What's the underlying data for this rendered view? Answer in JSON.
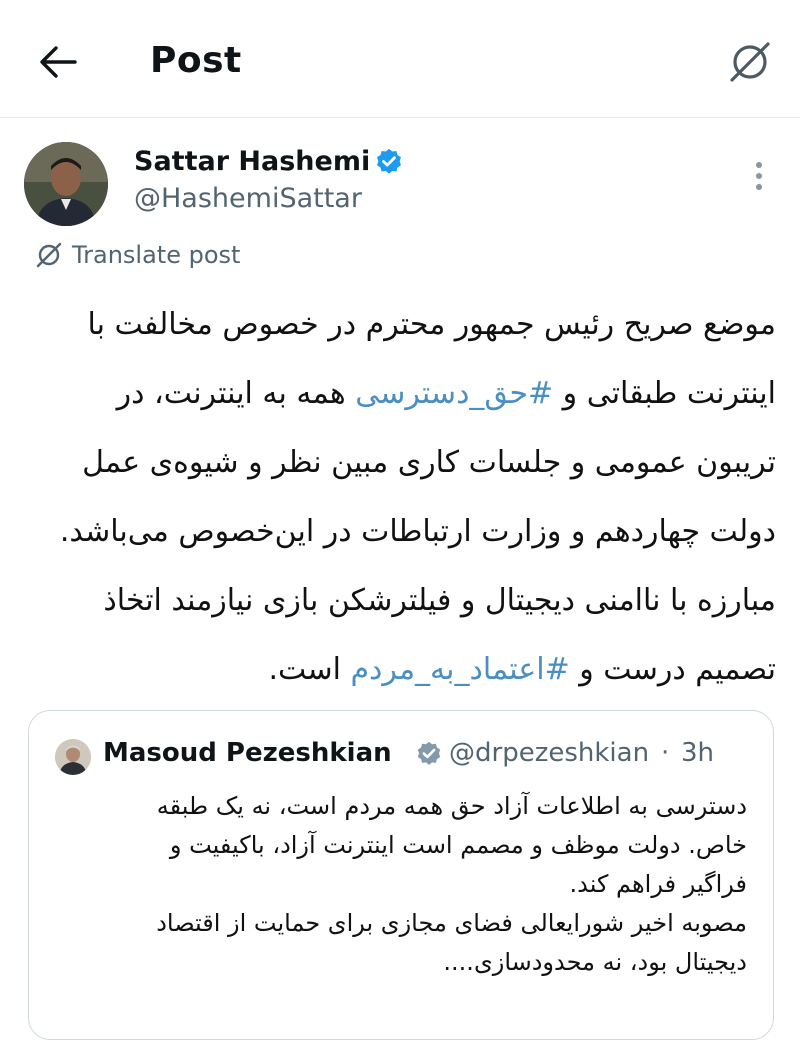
{
  "header": {
    "title": "Post",
    "back_icon": "arrow-left-icon",
    "right_icon": "no-translate-icon"
  },
  "post": {
    "author_name": "Sattar Hashemi",
    "author_handle": "@HashemiSattar",
    "verified": true,
    "translate_label": "Translate post",
    "text_segments": [
      {
        "type": "text",
        "value": "موضع صریح رئیس جمهور محترم در خصوص مخالفت با اینترنت طبقاتی و "
      },
      {
        "type": "hashtag",
        "value": "#حق_دسترسی"
      },
      {
        "type": "text",
        "value": " همه به اینترنت، در تریبون عمومی و جلسات کاری مبین نظر و شیوه‌ی عمل دولت چهاردهم و وزارت ارتباطات در این‌خصوص می‌باشد. مبارزه با ناامنی دیجیتال و فیلترشکن بازی نیازمند اتخاذ تصمیم درست و "
      },
      {
        "type": "hashtag",
        "value": "#اعتماد_به_مردم"
      },
      {
        "type": "text",
        "value": " است."
      }
    ]
  },
  "quote": {
    "author_name": "Masoud Pezeshkian",
    "author_handle": "@drpezeshkian",
    "separator": "·",
    "time": "3h",
    "verified_color": "#829aab",
    "lines": [
      "دسترسی به اطلاعات آزاد حق همه مردم است، نه یک طبقه خاص. دولت موظف و مصمم است اینترنت آزاد، باکیفیت و فراگیر فراهم کند.",
      "مصوبه اخیر شورایعالی فضای مجازی برای حمایت از اقتصاد دیجیتال بود، نه محدودسازی...."
    ]
  },
  "colors": {
    "hashtag": "#4a8ec2",
    "verified": "#1d9bf0",
    "secondary_text": "#536471",
    "border": "#cfd9de"
  }
}
